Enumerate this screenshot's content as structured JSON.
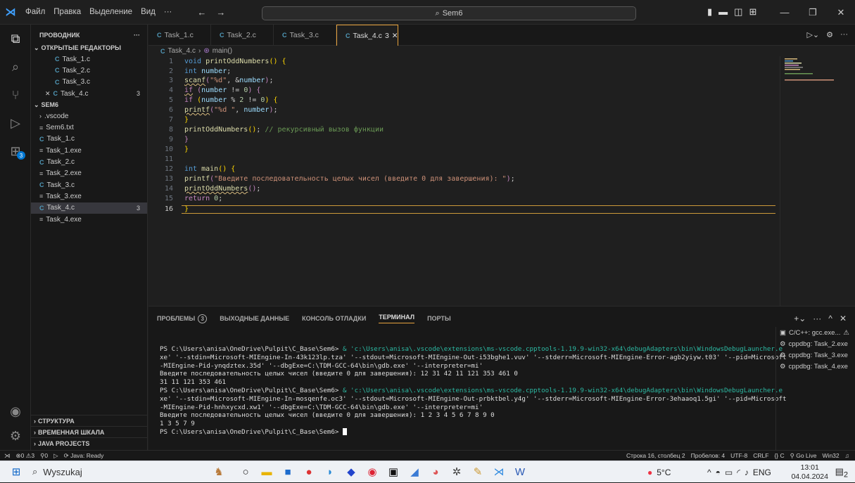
{
  "title_bar": {
    "menu": [
      "Файл",
      "Правка",
      "Выделение",
      "Вид",
      "···"
    ],
    "search": "Sem6"
  },
  "sidebar": {
    "header": "ПРОВОДНИК",
    "open_editors_title": "ОТКРЫТЫЕ РЕДАКТОРЫ",
    "open_editors": [
      {
        "name": "Task_1.c"
      },
      {
        "name": "Task_2.c"
      },
      {
        "name": "Task_3.c"
      },
      {
        "name": "Task_4.c",
        "badge": "3"
      }
    ],
    "folder_title": "SEM6",
    "files": [
      {
        "name": ".vscode",
        "type": "folder"
      },
      {
        "name": "Sem6.txt",
        "type": "text"
      },
      {
        "name": "Task_1.c",
        "type": "c"
      },
      {
        "name": "Task_1.exe",
        "type": "text"
      },
      {
        "name": "Task_2.c",
        "type": "c"
      },
      {
        "name": "Task_2.exe",
        "type": "text"
      },
      {
        "name": "Task_3.c",
        "type": "c"
      },
      {
        "name": "Task_3.exe",
        "type": "text"
      },
      {
        "name": "Task_4.c",
        "type": "c",
        "badge": "3"
      },
      {
        "name": "Task_4.exe",
        "type": "text"
      }
    ],
    "bottom_sections": [
      "СТРУКТУРА",
      "ВРЕМЕННАЯ ШКАЛА",
      "JAVA PROJECTS"
    ]
  },
  "tabs": [
    {
      "label": "Task_1.c"
    },
    {
      "label": "Task_2.c"
    },
    {
      "label": "Task_3.c"
    },
    {
      "label": "Task_4.c",
      "badge": "3"
    }
  ],
  "breadcrumb": {
    "file": "Task_4.c",
    "symbol": "main()"
  },
  "code_lines": [
    "1",
    "2",
    "3",
    "4",
    "5",
    "6",
    "7",
    "8",
    "9",
    "10",
    "11",
    "12",
    "13",
    "14",
    "15",
    "16"
  ],
  "panel": {
    "tabs": [
      "ПРОБЛЕМЫ",
      "ВЫХОДНЫЕ ДАННЫЕ",
      "КОНСОЛЬ ОТЛАДКИ",
      "ТЕРМИНАЛ",
      "ПОРТЫ"
    ],
    "problems_count": "3",
    "terminal_list": [
      "C/C++: gcc.exe...",
      "cppdbg: Task_2.exe",
      "cppdbg: Task_3.exe",
      "cppdbg: Task_4.exe"
    ]
  },
  "terminal": {
    "prompt": "PS C:\\Users\\anisa\\OneDrive\\Pulpit\\C_Base\\Sem6> ",
    "cmd1": "& 'c:\\Users\\anisa\\.vscode\\extensions\\ms-vscode.cpptools-1.19.9-win32-x64\\debugAdapters\\bin\\WindowsDebugLauncher.e",
    "cmd1b": "xe' '--stdin=Microsoft-MIEngine-In-43k123lp.tza' '--stdout=Microsoft-MIEngine-Out-i53bghe1.vuv' '--stderr=Microsoft-MIEngine-Error-agb2yiyw.t03' '--pid=Microsoft",
    "cmd1c": "-MIEngine-Pid-ynqdztex.35d' '--dbgExe=C:\\TDM-GCC-64\\bin\\gdb.exe' '--interpreter=mi'",
    "out1": "Введите последовательность целых чисел (введите 0 для завершения): 12 31 42 11 121 353 461 0",
    "out2": "31 11 121 353 461",
    "cmd2": "& 'c:\\Users\\anisa\\.vscode\\extensions\\ms-vscode.cpptools-1.19.9-win32-x64\\debugAdapters\\bin\\WindowsDebugLauncher.e",
    "cmd2b": "xe' '--stdin=Microsoft-MIEngine-In-mosqenfe.oc3' '--stdout=Microsoft-MIEngine-Out-prbktbel.y4g' '--stderr=Microsoft-MIEngine-Error-3ehaaoq1.5gi' '--pid=Microsoft",
    "cmd2c": "-MIEngine-Pid-hnhxycxd.xw1' '--dbgExe=C:\\TDM-GCC-64\\bin\\gdb.exe' '--interpreter=mi'",
    "out3": "Введите последовательность целых чисел (введите 0 для завершения): 1 2 3 4 5 6 7 8 9 0",
    "out4": "1 3 5 7 9",
    "last": "PS C:\\Users\\anisa\\OneDrive\\Pulpit\\C_Base\\Sem6>"
  },
  "status": {
    "errors": "0",
    "warnings": "3",
    "ports": "0",
    "java": "Java: Ready",
    "position": "Строка 16, столбец 2",
    "spaces": "Пробелов: 4",
    "encoding": "UTF-8",
    "eol": "CRLF",
    "lang": "C",
    "golive": "Go Live",
    "platform": "Win32"
  },
  "taskbar": {
    "search": "Wyszukaj",
    "weather": "5°C",
    "lang": "ENG",
    "time": "13:01",
    "date": "04.04.2024",
    "notif": "2"
  },
  "colors": {
    "accent": "#e8a33d",
    "c_icon": "#519aba",
    "string": "#ce9178",
    "keyword": "#569cd6"
  }
}
